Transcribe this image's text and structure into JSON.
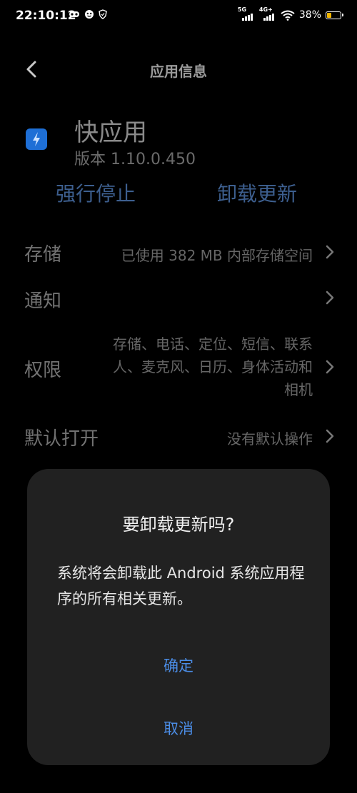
{
  "status_bar": {
    "time": "22:10:12",
    "signal1_label": "5G",
    "signal2_label": "4G+",
    "battery_text": "38%",
    "battery_level": 0.38,
    "battery_color": "#f2b500"
  },
  "header": {
    "title": "应用信息",
    "back_icon": "chevron-left-icon"
  },
  "app": {
    "name": "快应用",
    "version": "版本 1.10.0.450",
    "icon": "lightning-icon",
    "icon_color": "#1e6fd6"
  },
  "actions": {
    "force_stop": "强行停止",
    "uninstall_updates": "卸载更新"
  },
  "rows": {
    "storage": {
      "label": "存储",
      "value": "已使用 382 MB 内部存储空间"
    },
    "notifications": {
      "label": "通知"
    },
    "permissions": {
      "label": "权限",
      "value_lines": [
        "存储、电话、定位、短信、联系",
        "人、麦克风、日历、身体活动和",
        "相机"
      ]
    },
    "default_open": {
      "label": "默认打开",
      "value": "没有默认操作"
    }
  },
  "dialog": {
    "title": "要卸载更新吗?",
    "message": "系统将会卸载此 Android 系统应用程序的所有相关更新。",
    "ok": "确定",
    "cancel": "取消",
    "accent": "#4b8de6"
  }
}
